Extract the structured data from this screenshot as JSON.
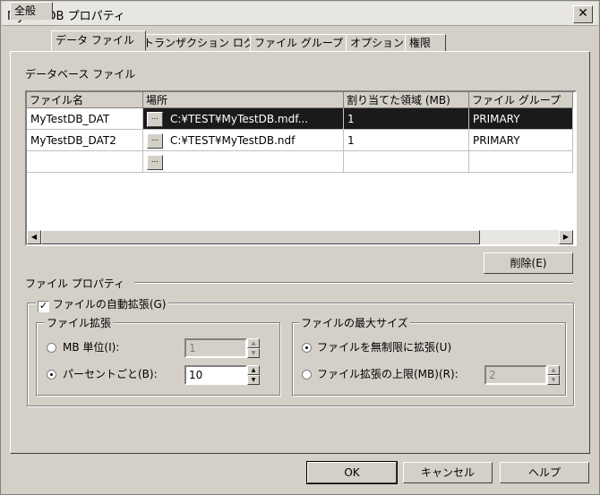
{
  "window": {
    "title": "MyTestDB プロパティ",
    "close": "✕"
  },
  "tabs": [
    "全般",
    "データ ファイル",
    "トランザクション ログ",
    "ファイル グループ",
    "オプション",
    "権限"
  ],
  "files_section": {
    "label": "データベース ファイル"
  },
  "grid": {
    "headers": [
      "ファイル名",
      "場所",
      "割り当てた領域 (MB)",
      "ファイル グループ"
    ],
    "rows": [
      {
        "name": "MyTestDB_DAT",
        "browse": "...",
        "location": "C:¥TEST¥MyTestDB.mdf...",
        "size": "1",
        "group": "PRIMARY"
      },
      {
        "name": "MyTestDB_DAT2",
        "browse": "...",
        "location": "C:¥TEST¥MyTestDB.ndf",
        "size": "1",
        "group": "PRIMARY"
      },
      {
        "name": "",
        "browse": "...",
        "location": "",
        "size": "",
        "group": ""
      }
    ],
    "scroll_left": "◀",
    "scroll_right": "▶"
  },
  "delete_button": "削除(E)",
  "file_properties": {
    "label": "ファイル プロパティ",
    "autogrow_label": "ファイルの自動拡張(G)",
    "autogrow_checked": "✓",
    "growth": {
      "label": "ファイル拡張",
      "mb_label": "MB 単位(I):",
      "mb_value": "1",
      "percent_label": "パーセントごと(B):",
      "percent_value": "10"
    },
    "maxsize": {
      "label": "ファイルの最大サイズ",
      "unlimited_label": "ファイルを無制限に拡張(U)",
      "limit_label": "ファイル拡張の上限(MB)(R):",
      "limit_value": "2"
    }
  },
  "spin": {
    "up": "▲",
    "down": "▼"
  },
  "buttons": {
    "ok": "OK",
    "cancel": "キャンセル",
    "help": "ヘルプ"
  }
}
